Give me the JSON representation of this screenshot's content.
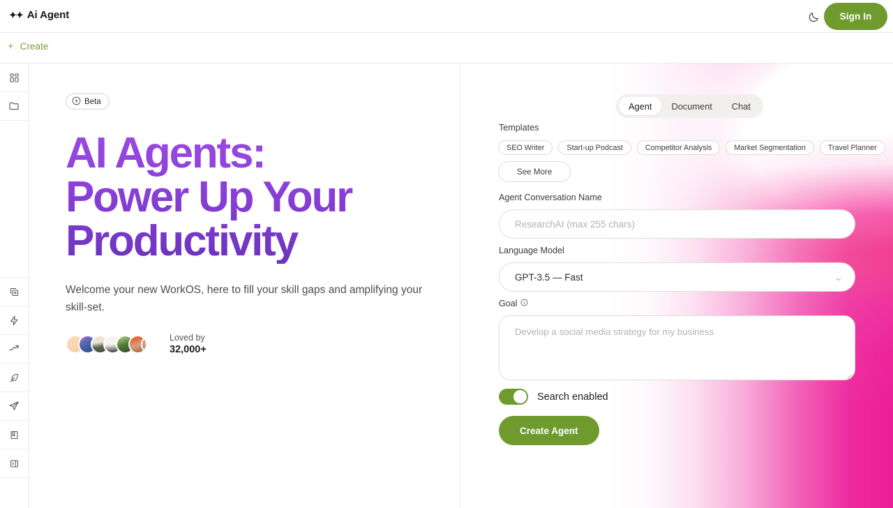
{
  "header": {
    "sparkle_glyphs": "✦✦",
    "brand": "Ai Agent",
    "theme_toggle_icon": "moon-icon",
    "signin_label": "Sign In"
  },
  "createbar": {
    "plus": "+",
    "label": "Create"
  },
  "sidebar": {
    "items": [
      {
        "icon": "grid-dashboard-icon",
        "name": "sidebar-item-dashboard"
      },
      {
        "icon": "folder-icon",
        "name": "sidebar-item-folder"
      },
      {
        "icon": "copy-add-icon",
        "name": "sidebar-item-duplicate"
      },
      {
        "icon": "lightning-icon",
        "name": "sidebar-item-automations"
      },
      {
        "icon": "trending-up-icon",
        "name": "sidebar-item-analytics"
      },
      {
        "icon": "feather-pen-icon",
        "name": "sidebar-item-write"
      },
      {
        "icon": "paper-plane-icon",
        "name": "sidebar-item-send"
      },
      {
        "icon": "book-icon",
        "name": "sidebar-item-library"
      },
      {
        "icon": "panel-collapse-icon",
        "name": "sidebar-item-collapse"
      }
    ]
  },
  "hero": {
    "badge": {
      "icon": "lightning-icon",
      "label": "Beta"
    },
    "title_line1": "AI Agents:",
    "title_line2": "Power Up Your",
    "title_line3": "Productivity",
    "subtitle": "Welcome your new WorkOS, here to fill your skill gaps and amplifying your skill-set.",
    "social_proof": {
      "line1": "Loved by",
      "line2": "32,000+",
      "avatar_count": 7
    },
    "title_gradient_from": "#9b4ae3",
    "title_gradient_to": "#6a33bd"
  },
  "panel": {
    "tabs": [
      {
        "label": "Agent",
        "active": true
      },
      {
        "label": "Document",
        "active": false
      },
      {
        "label": "Chat",
        "active": false
      }
    ],
    "templates_label": "Templates",
    "template_chips": [
      "SEO Writer",
      "Start-up Podcast",
      "Competitor Analysis",
      "Market Segmentation",
      "Travel Planner"
    ],
    "see_more_label": "See More",
    "conversation": {
      "label": "Agent Conversation Name",
      "placeholder": "ResearchAI (max 255 chars)",
      "value": ""
    },
    "model": {
      "label": "Language Model",
      "selected": "GPT-3.5 — Fast",
      "chevron_icon": "chevron-down-icon"
    },
    "goal": {
      "label": "Goal",
      "info_icon": "info-circle-icon",
      "placeholder": "Develop a social media strategy for my business",
      "value": ""
    },
    "search_toggle": {
      "label": "Search enabled",
      "enabled": true
    },
    "submit_label": "Create Agent",
    "accent_green": "#6f9b2e",
    "gradient_magenta": "#ee2ca0",
    "gradient_peach": "#fce7c9"
  }
}
